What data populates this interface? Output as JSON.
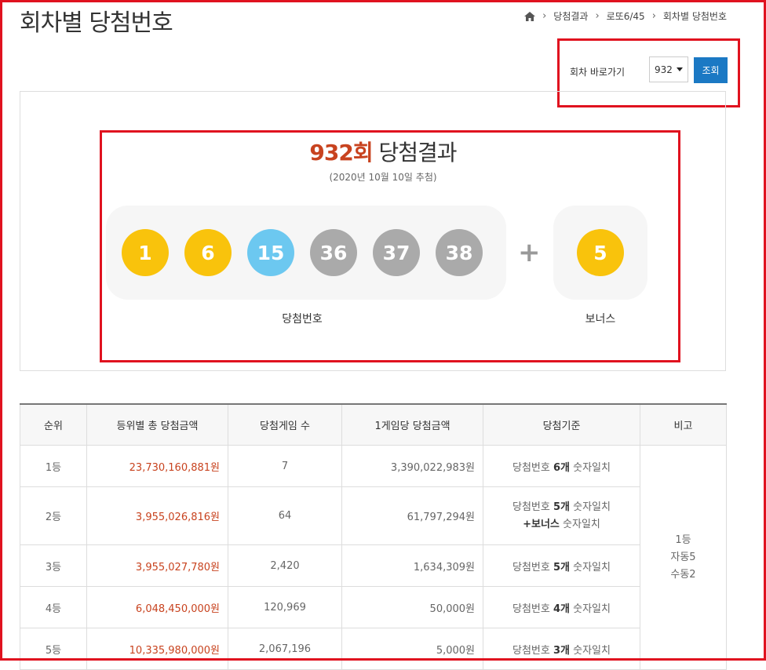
{
  "page": {
    "title": "회차별 당첨번호"
  },
  "breadcrumb": {
    "items": [
      "당첨결과",
      "로또6/45",
      "회차별 당첨번호"
    ]
  },
  "round_jump": {
    "label": "회차 바로가기",
    "selected": "932",
    "button": "조회"
  },
  "result": {
    "round_number": "932회",
    "heading_suffix": " 당첨결과",
    "draw_date": "(2020년 10월 10일 추첨)",
    "numbers": [
      {
        "value": "1",
        "color": "#f9c30c"
      },
      {
        "value": "6",
        "color": "#f9c30c"
      },
      {
        "value": "15",
        "color": "#6cc8f0"
      },
      {
        "value": "36",
        "color": "#aaaaaa"
      },
      {
        "value": "37",
        "color": "#aaaaaa"
      },
      {
        "value": "38",
        "color": "#aaaaaa"
      }
    ],
    "plus": "+",
    "bonus": {
      "value": "5",
      "color": "#f9c30c"
    },
    "numbers_caption": "당첨번호",
    "bonus_caption": "보너스"
  },
  "table": {
    "headers": [
      "순위",
      "등위별 총 당첨금액",
      "당첨게임 수",
      "1게임당 당첨금액",
      "당첨기준",
      "비고"
    ],
    "rows": [
      {
        "rank": "1등",
        "total": "23,730,160,881원",
        "games": "7",
        "per_game": "3,390,022,983원",
        "crit_pre": "당첨번호 ",
        "crit_bold": "6개",
        "crit_post": " 숫자일치"
      },
      {
        "rank": "2등",
        "total": "3,955,026,816원",
        "games": "64",
        "per_game": "61,797,294원",
        "crit_pre": "당첨번호 ",
        "crit_bold": "5개",
        "crit_post": " 숫자일치",
        "crit2_bold": "+보너스",
        "crit2_post": " 숫자일치"
      },
      {
        "rank": "3등",
        "total": "3,955,027,780원",
        "games": "2,420",
        "per_game": "1,634,309원",
        "crit_pre": "당첨번호 ",
        "crit_bold": "5개",
        "crit_post": " 숫자일치"
      },
      {
        "rank": "4등",
        "total": "6,048,450,000원",
        "games": "120,969",
        "per_game": "50,000원",
        "crit_pre": "당첨번호 ",
        "crit_bold": "4개",
        "crit_post": " 숫자일치"
      },
      {
        "rank": "5등",
        "total": "10,335,980,000원",
        "games": "2,067,196",
        "per_game": "5,000원",
        "crit_pre": "당첨번호 ",
        "crit_bold": "3개",
        "crit_post": " 숫자일치"
      }
    ],
    "note": [
      "1등",
      "자동5",
      "수동2"
    ]
  },
  "colors": {
    "accent": "#c8431f",
    "button": "#1b79c4",
    "annotation": "#e0121f"
  }
}
